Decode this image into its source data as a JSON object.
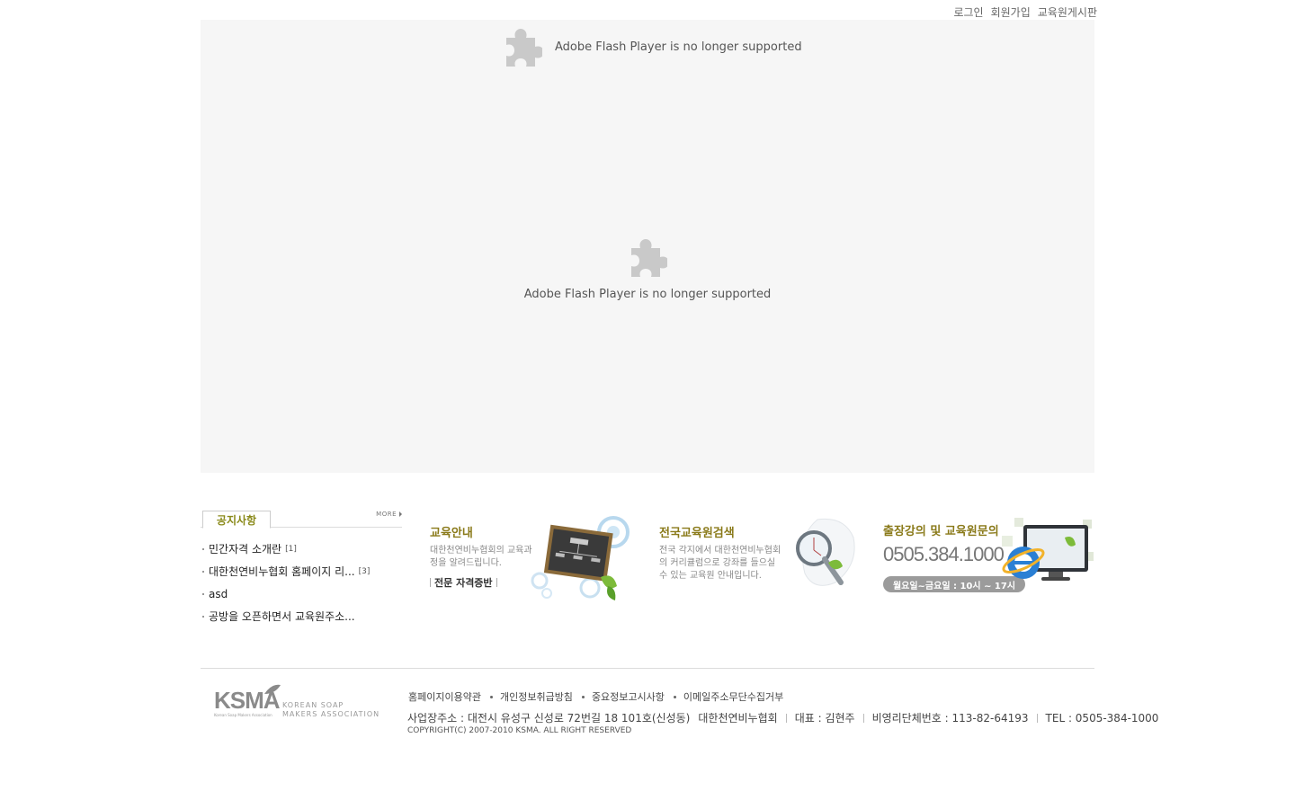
{
  "top_links": [
    "로그인",
    "회원가입",
    "교육원게시판"
  ],
  "flash": {
    "message_top": "Adobe Flash Player is no longer supported",
    "message_center": "Adobe Flash Player is no longer supported"
  },
  "notice": {
    "tab_label": "공지사항",
    "more_label": "MORE",
    "items": [
      {
        "title": "민간자격 소개란",
        "count": "[1]"
      },
      {
        "title": "대한천연비누협회 홈페이지 리...",
        "count": "[3]"
      },
      {
        "title": "asd",
        "count": ""
      },
      {
        "title": "공방을 오픈하면서 교육원주소...",
        "count": ""
      }
    ]
  },
  "banners": {
    "education": {
      "title": "교육안내",
      "desc": "대한천연비누협회의 교육과\n정을 알려드립니다.",
      "link": "전문 자격증반"
    },
    "search": {
      "title": "전국교육원검색",
      "desc": "전국 각지에서 대한천연비누협회\n의 커리큘럼으로 강좌를 들으실\n수 있는 교육원 안내입니다."
    },
    "contact": {
      "title": "출장강의 및 교육원문의",
      "phone": "0505.384.1000",
      "hours": "월요일~금요일 : 10시 ~ 17시"
    }
  },
  "footer": {
    "logo_text": "KSMA",
    "logo_sub": "Korean Soap Makers Association",
    "logo_en": "KOREAN SOAP\nMAKERS ASSOCIATION",
    "menu": [
      "홈페이지이용약관",
      "개인정보취급방침",
      "중요정보고시사항",
      "이메일주소무단수집거부"
    ],
    "address": "사업장주소 : 대전시 유성구 신성로 72번길 18 101호(신성동)",
    "org": "대한천연비누협회",
    "rep": "대표 : 김현주",
    "reg": "비영리단체번호 : 113-82-64193",
    "tel": "TEL : 0505-384-1000",
    "copyright": "COPYRIGHT(C) 2007-2010 KSMA. ALL RIGHT RESERVED"
  },
  "colors": {
    "flash_bg": "#f6f6f6",
    "title_accent": "#8a7a1a",
    "divider": "#dcdcdc"
  }
}
